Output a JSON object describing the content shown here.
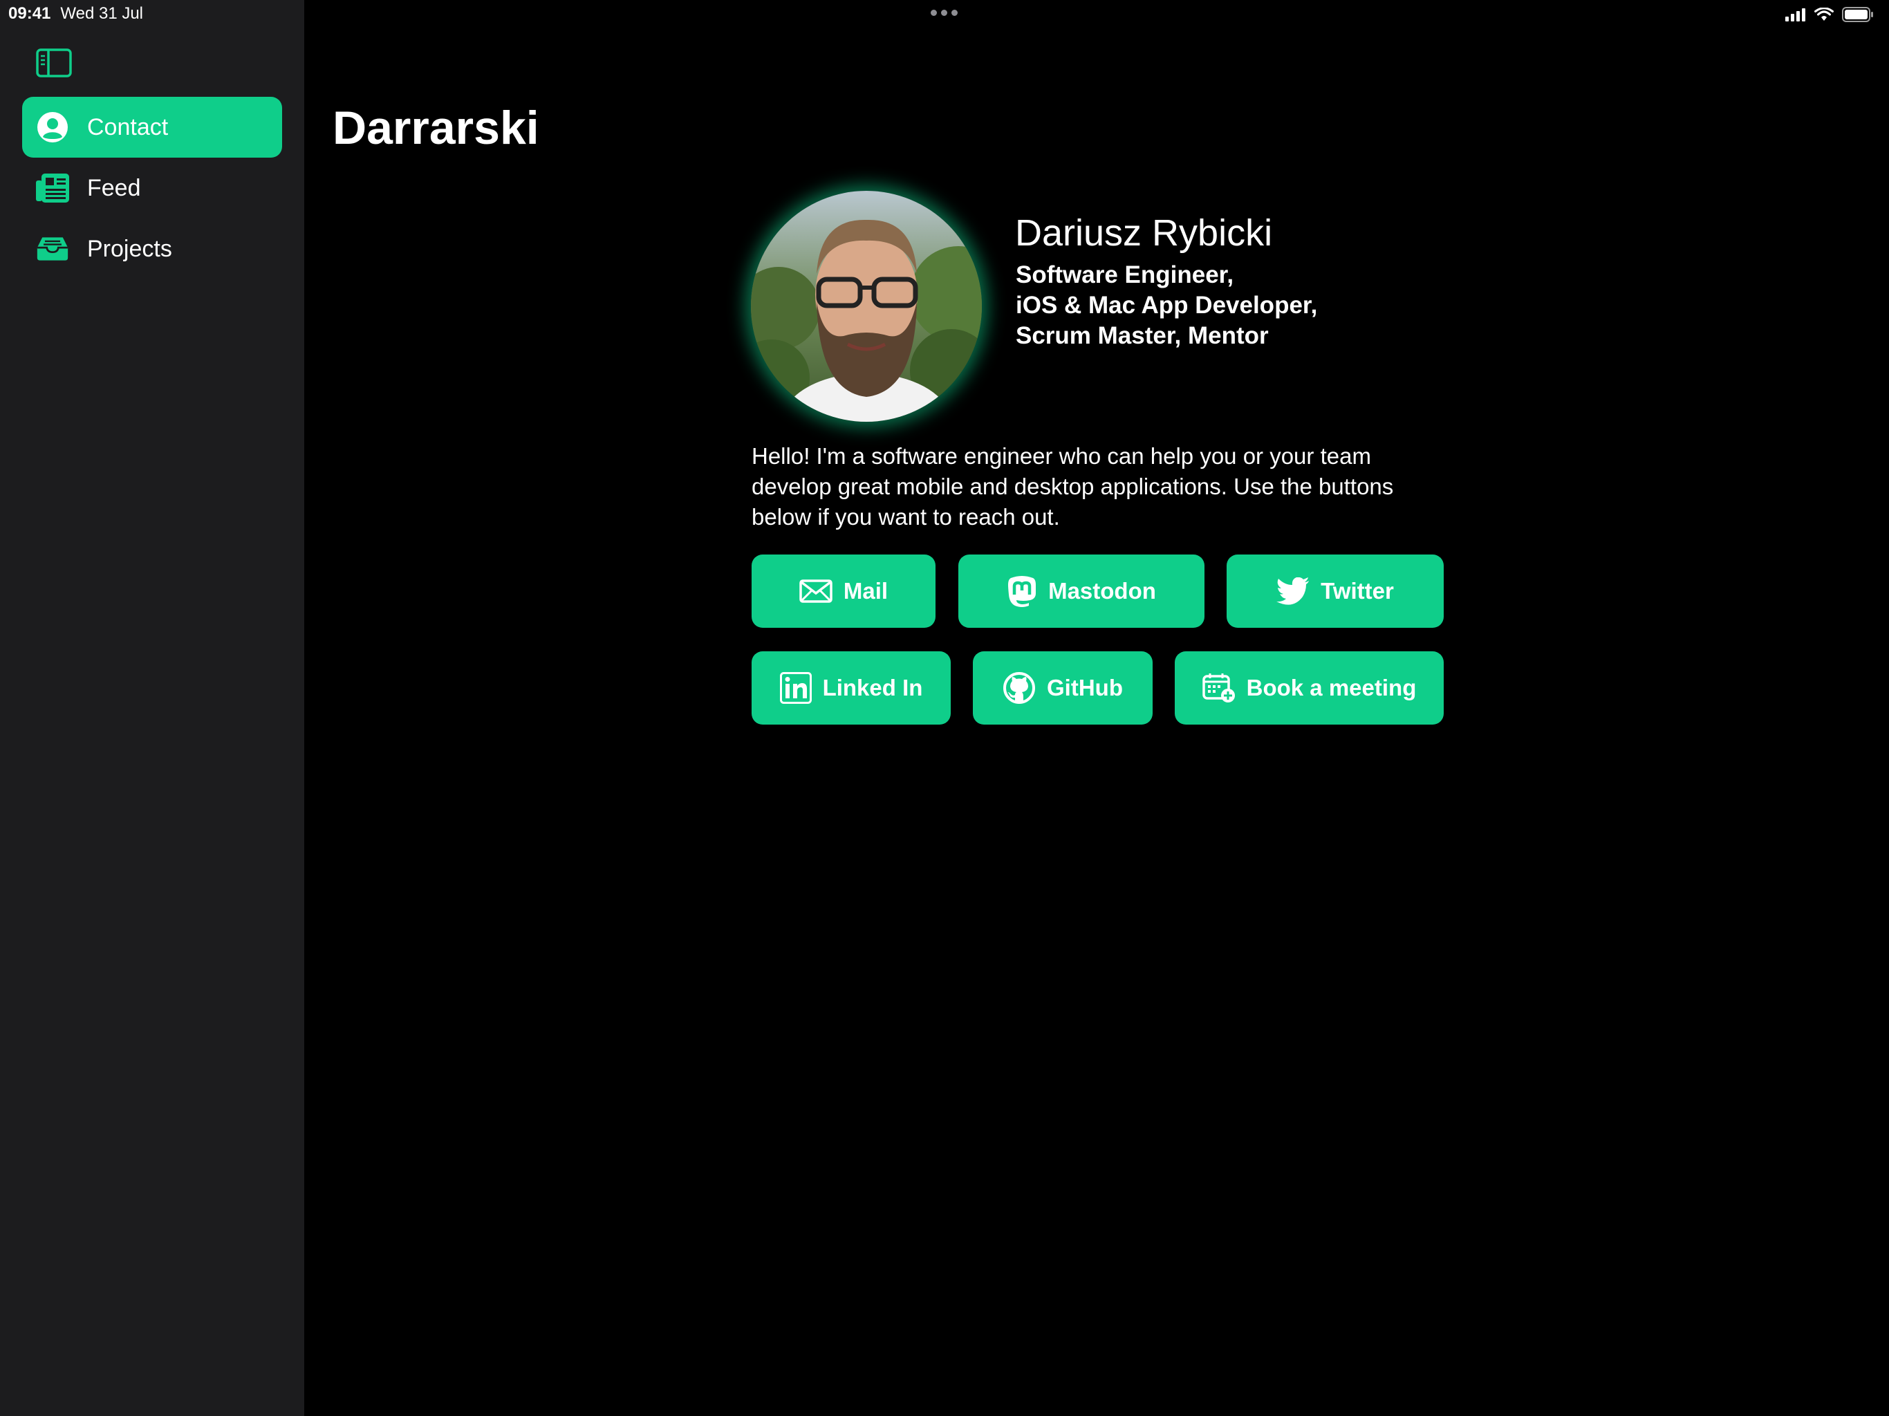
{
  "status_bar": {
    "time": "09:41",
    "date": "Wed 31 Jul"
  },
  "sidebar": {
    "items": [
      {
        "label": "Contact",
        "icon": "person-circle-icon",
        "active": true
      },
      {
        "label": "Feed",
        "icon": "newspaper-icon",
        "active": false
      },
      {
        "label": "Projects",
        "icon": "tray-icon",
        "active": false
      }
    ]
  },
  "main": {
    "title": "Darrarski",
    "profile": {
      "name": "Dariusz Rybicki",
      "roles": [
        "Software Engineer,",
        "iOS & Mac App Developer,",
        "Scrum Master, Mentor"
      ],
      "bio": "Hello! I'm a software engineer who can help you or your team develop great mobile and desktop applications. Use the buttons below if you want to reach out."
    },
    "buttons": [
      {
        "label": "Mail",
        "icon": "envelope-icon"
      },
      {
        "label": "Mastodon",
        "icon": "mastodon-icon"
      },
      {
        "label": "Twitter",
        "icon": "twitter-icon"
      },
      {
        "label": "Linked In",
        "icon": "linkedin-icon"
      },
      {
        "label": "GitHub",
        "icon": "github-icon"
      },
      {
        "label": "Book a meeting",
        "icon": "calendar-add-icon"
      }
    ]
  },
  "colors": {
    "accent": "#0fce8a",
    "sidebar_bg": "#1c1c1e",
    "background": "#000000"
  }
}
